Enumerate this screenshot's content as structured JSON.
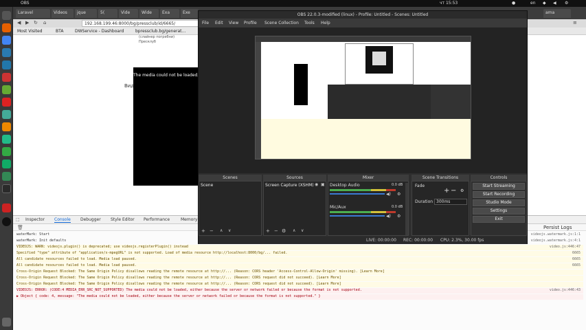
{
  "topbar": {
    "app": "OBS",
    "clock": "чт 15:53",
    "lang": "en"
  },
  "browser": {
    "tabs": [
      "Laravel",
      "Videos",
      "jque",
      "5(",
      "Vide",
      "Wide",
      "Exa",
      "Exe",
      "ama"
    ],
    "url": "192.168.199.46:8000/bg/pressclub/id/6665/",
    "bookmarks": [
      "Most Visited",
      "BTA",
      "DWService - Dashboard",
      "bpressclub.bg/generat..."
    ],
    "page": {
      "text_lines": [
        "(слайнер погребни)",
        "Пресклуб"
      ],
      "video_label": "Видео:",
      "video_error": "The media could not be loaded, e"
    },
    "devtools": {
      "tabs": [
        "Inspector",
        "Console",
        "Debugger",
        "Style Editor",
        "Performance",
        "Memory"
      ],
      "persist_label": "Persist Logs",
      "log": [
        {
          "type": "log",
          "text": "waterMark: Start",
          "src": "videojs.watermark.js:1:1"
        },
        {
          "type": "log",
          "text": "waterMark: Init defaults",
          "src": "videojs.watermark.js:4:1"
        },
        {
          "type": "warn",
          "text": "VIDEOJS: WARN: videojs.plugin() is deprecated; use videojs.registerPlugin() instead",
          "src": "video.js:446:47"
        },
        {
          "type": "warn",
          "text": "Specified \"type\" attribute of \"application/x-mpegURL\" is not supported. Load of media resource http://localhost:8000/bg/... failed.",
          "src": "6665"
        },
        {
          "type": "warn",
          "text": "All candidate resources failed to load. Media load paused.",
          "src": "6665"
        },
        {
          "type": "warn",
          "text": "All candidate resources failed to load. Media load paused.",
          "src": "6665"
        },
        {
          "type": "warn",
          "text": "Cross-Origin Request Blocked: The Same Origin Policy disallows reading the remote resource at http://... (Reason: CORS header 'Access-Control-Allow-Origin' missing). [Learn More]",
          "src": ""
        },
        {
          "type": "warn",
          "text": "Cross-Origin Request Blocked: The Same Origin Policy disallows reading the remote resource at http://... (Reason: CORS request did not succeed). [Learn More]",
          "src": ""
        },
        {
          "type": "warn",
          "text": "Cross-Origin Request Blocked: The Same Origin Policy disallows reading the remote resource at http://... (Reason: CORS request did not succeed). [Learn More]",
          "src": ""
        },
        {
          "type": "err",
          "text": "VIDEOJS: ERROR: (CODE:4 MEDIA_ERR_SRC_NOT_SUPPORTED) The media could not be loaded, either because the server or network failed or because the format is not supported.",
          "src": "video.js:446:43"
        },
        {
          "type": "err",
          "text": "▶ Object { code: 4, message: \"The media could not be loaded, either because the server or network failed or because the format is not supported.\" }",
          "src": ""
        }
      ]
    }
  },
  "obs": {
    "title": "OBS 22.0.3-modified (linux) - Profile: Untitled - Scenes: Untitled",
    "menu": [
      "File",
      "Edit",
      "View",
      "Profile",
      "Scene Collection",
      "Tools",
      "Help"
    ],
    "docks": {
      "scenes": {
        "title": "Scenes",
        "items": [
          "Scene"
        ]
      },
      "sources": {
        "title": "Sources",
        "items": [
          "Screen Capture (XSHM)"
        ]
      },
      "mixer": {
        "title": "Mixer",
        "channels": [
          {
            "name": "Desktop Audio",
            "level": "0.0 dB"
          },
          {
            "name": "Mic/Aux",
            "level": "0.0 dB"
          }
        ]
      },
      "transitions": {
        "title": "Scene Transitions",
        "type": "Fade",
        "duration_label": "Duration",
        "duration": "300ms"
      },
      "controls": {
        "title": "Controls",
        "buttons": [
          "Start Streaming",
          "Start Recording",
          "Studio Mode",
          "Settings",
          "Exit"
        ]
      }
    },
    "status": {
      "live": "LIVE: 00:00:00",
      "rec": "REC: 00:00:00",
      "cpu": "CPU: 2.3%, 30.00 fps"
    }
  },
  "colors": {
    "obs_bg": "#2f2f2f",
    "dock_bg": "#262626",
    "meter_green": "#4caf50",
    "meter_yellow": "#d4c23a",
    "meter_red": "#c0392b",
    "accent_blue": "#3a7bd5"
  }
}
